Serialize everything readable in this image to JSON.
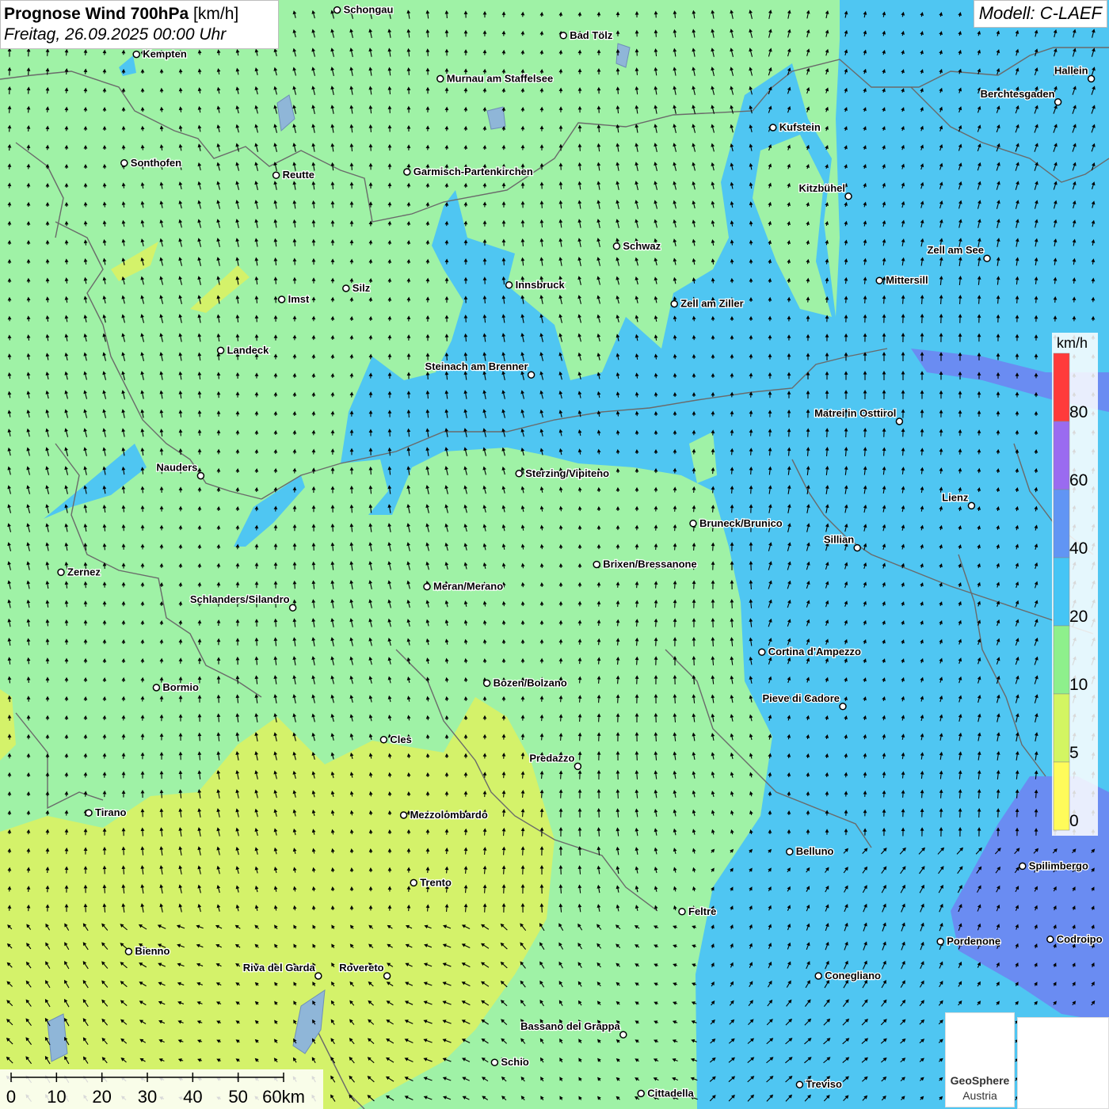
{
  "header": {
    "title_bold": "Prognose Wind 700hPa",
    "title_unit": " [km/h]",
    "subtitle": "Freitag, 26.09.2025 00:00 Uhr",
    "model": "Modell: C-LAEF"
  },
  "legend": {
    "unit": "km/h",
    "classes": [
      {
        "label": "80",
        "color": "#ff3b3b"
      },
      {
        "label": "60",
        "color": "#9a6bf0"
      },
      {
        "label": "40",
        "color": "#6195f4"
      },
      {
        "label": "20",
        "color": "#45c5f5"
      },
      {
        "label": "10",
        "color": "#8ef08c"
      },
      {
        "label": "5",
        "color": "#d3f562"
      },
      {
        "label": "0",
        "color": "#fffb5a"
      }
    ]
  },
  "scale": {
    "ticks": [
      "0",
      "10",
      "20",
      "30",
      "40",
      "50",
      "60km"
    ]
  },
  "logo": {
    "line1": "GeoSphere",
    "line2": "Austria"
  },
  "colors": {
    "calm": "#d4f26a",
    "light": "#9ff2a6",
    "moderate": "#4fc6f2",
    "strong": "#6a8cf2"
  },
  "places": [
    {
      "name": "Schongau",
      "lx": 0.304,
      "ly": 0.009,
      "side": "r"
    },
    {
      "name": "Bad Tölz",
      "lx": 0.508,
      "ly": 0.032,
      "side": "r"
    },
    {
      "name": "Kempten",
      "lx": 0.123,
      "ly": 0.049,
      "side": "r"
    },
    {
      "name": "Murnau am Staffelsee",
      "lx": 0.397,
      "ly": 0.071,
      "side": "r"
    },
    {
      "name": "Hallein",
      "lx": 0.984,
      "ly": 0.071,
      "side": "l"
    },
    {
      "name": "Berchtesgaden",
      "lx": 0.954,
      "ly": 0.092,
      "side": "l"
    },
    {
      "name": "Kufstein",
      "lx": 0.697,
      "ly": 0.115,
      "side": "r"
    },
    {
      "name": "Sonthofen",
      "lx": 0.112,
      "ly": 0.147,
      "side": "r"
    },
    {
      "name": "Reutte",
      "lx": 0.249,
      "ly": 0.158,
      "side": "r"
    },
    {
      "name": "Garmisch-Partenkirchen",
      "lx": 0.367,
      "ly": 0.155,
      "side": "r"
    },
    {
      "name": "Kitzbühel",
      "lx": 0.765,
      "ly": 0.177,
      "side": "l"
    },
    {
      "name": "Schwaz",
      "lx": 0.556,
      "ly": 0.222,
      "side": "r"
    },
    {
      "name": "Zell am See",
      "lx": 0.89,
      "ly": 0.233,
      "side": "l"
    },
    {
      "name": "Mittersill",
      "lx": 0.793,
      "ly": 0.253,
      "side": "r"
    },
    {
      "name": "Innsbruck",
      "lx": 0.459,
      "ly": 0.257,
      "side": "r"
    },
    {
      "name": "Silz",
      "lx": 0.312,
      "ly": 0.26,
      "side": "r"
    },
    {
      "name": "Imst",
      "lx": 0.254,
      "ly": 0.27,
      "side": "r"
    },
    {
      "name": "Zell am Ziller",
      "lx": 0.608,
      "ly": 0.274,
      "side": "r"
    },
    {
      "name": "Landeck",
      "lx": 0.199,
      "ly": 0.316,
      "side": "r"
    },
    {
      "name": "Steinach am Brenner",
      "lx": 0.479,
      "ly": 0.338,
      "side": "l"
    },
    {
      "name": "Matrei in Osttirol",
      "lx": 0.811,
      "ly": 0.38,
      "side": "l"
    },
    {
      "name": "Nauders",
      "lx": 0.181,
      "ly": 0.429,
      "side": "l"
    },
    {
      "name": "Sterzing/Vipiteno",
      "lx": 0.468,
      "ly": 0.427,
      "side": "r"
    },
    {
      "name": "Lienz",
      "lx": 0.876,
      "ly": 0.456,
      "side": "l"
    },
    {
      "name": "Bruneck/Brunico",
      "lx": 0.625,
      "ly": 0.472,
      "side": "r"
    },
    {
      "name": "Sillian",
      "lx": 0.773,
      "ly": 0.494,
      "side": "l"
    },
    {
      "name": "Brixen/Bressanone",
      "lx": 0.538,
      "ly": 0.509,
      "side": "r"
    },
    {
      "name": "Zernez",
      "lx": 0.055,
      "ly": 0.516,
      "side": "r"
    },
    {
      "name": "Meran/Merano",
      "lx": 0.385,
      "ly": 0.529,
      "side": "r"
    },
    {
      "name": "Schlanders/Silandro",
      "lx": 0.264,
      "ly": 0.548,
      "side": "l"
    },
    {
      "name": "Cortina d'Ampezzo",
      "lx": 0.687,
      "ly": 0.588,
      "side": "r"
    },
    {
      "name": "Bozen/Bolzano",
      "lx": 0.439,
      "ly": 0.616,
      "side": "r"
    },
    {
      "name": "Bormio",
      "lx": 0.141,
      "ly": 0.62,
      "side": "r"
    },
    {
      "name": "Pieve di Cadore",
      "lx": 0.76,
      "ly": 0.637,
      "side": "l"
    },
    {
      "name": "Cles",
      "lx": 0.346,
      "ly": 0.667,
      "side": "r"
    },
    {
      "name": "Predazzo",
      "lx": 0.521,
      "ly": 0.691,
      "side": "l"
    },
    {
      "name": "Tirano",
      "lx": 0.08,
      "ly": 0.733,
      "side": "r"
    },
    {
      "name": "Mezzolombardo",
      "lx": 0.364,
      "ly": 0.735,
      "side": "r"
    },
    {
      "name": "Belluno",
      "lx": 0.712,
      "ly": 0.768,
      "side": "r"
    },
    {
      "name": "Spilimbergo",
      "lx": 0.922,
      "ly": 0.781,
      "side": "r"
    },
    {
      "name": "Trento",
      "lx": 0.373,
      "ly": 0.796,
      "side": "r"
    },
    {
      "name": "Feltre",
      "lx": 0.615,
      "ly": 0.822,
      "side": "r"
    },
    {
      "name": "Pordenone",
      "lx": 0.848,
      "ly": 0.849,
      "side": "r"
    },
    {
      "name": "Codroipo",
      "lx": 0.947,
      "ly": 0.847,
      "side": "r"
    },
    {
      "name": "Bienno",
      "lx": 0.116,
      "ly": 0.858,
      "side": "r"
    },
    {
      "name": "Riva del Garda",
      "lx": 0.287,
      "ly": 0.88,
      "side": "l"
    },
    {
      "name": "Rovereto",
      "lx": 0.349,
      "ly": 0.88,
      "side": "l"
    },
    {
      "name": "Conegliano",
      "lx": 0.738,
      "ly": 0.88,
      "side": "r"
    },
    {
      "name": "Bassano del Grappa",
      "lx": 0.562,
      "ly": 0.933,
      "side": "l"
    },
    {
      "name": "Schio",
      "lx": 0.446,
      "ly": 0.958,
      "side": "r"
    },
    {
      "name": "Treviso",
      "lx": 0.721,
      "ly": 0.978,
      "side": "r"
    },
    {
      "name": "Cittadella",
      "lx": 0.578,
      "ly": 0.986,
      "side": "r"
    }
  ]
}
